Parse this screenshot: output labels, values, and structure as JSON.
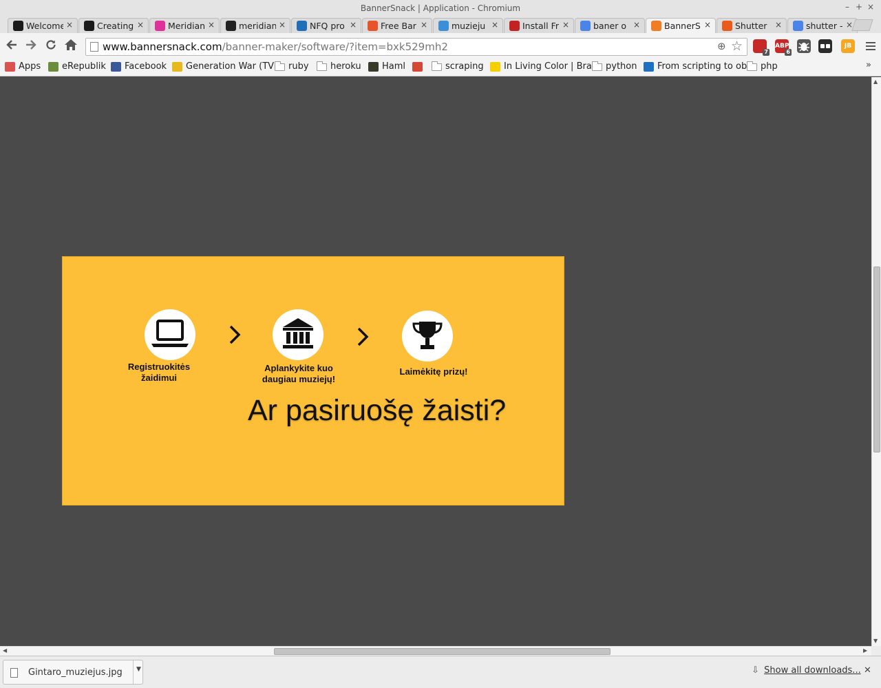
{
  "window": {
    "title": "BannerSnack | Application - Chromium",
    "controls": [
      "–",
      "+",
      "×"
    ]
  },
  "tabs": [
    {
      "label": "Welcome",
      "favicon_color": "#1a1a1a",
      "active": false
    },
    {
      "label": "Creating",
      "favicon_color": "#1a1a1a",
      "active": false
    },
    {
      "label": "Meridian",
      "favicon_color": "#e0309a",
      "active": false
    },
    {
      "label": "meridian",
      "favicon_color": "#222222",
      "active": false
    },
    {
      "label": "NFQ pro",
      "favicon_color": "#1f6fb8",
      "active": false
    },
    {
      "label": "Free Bar",
      "favicon_color": "#e7542b",
      "active": false
    },
    {
      "label": "muzieju",
      "favicon_color": "#3b8fd6",
      "active": false
    },
    {
      "label": "Install Fr",
      "favicon_color": "#c22222",
      "active": false
    },
    {
      "label": "baner o",
      "favicon_color": "#4a84e8",
      "active": false
    },
    {
      "label": "BannerS",
      "favicon_color": "#f07c23",
      "active": true
    },
    {
      "label": "Shutter",
      "favicon_color": "#e95a1d",
      "active": false
    },
    {
      "label": "shutter -",
      "favicon_color": "#4a84e8",
      "active": false
    }
  ],
  "toolbar": {
    "back_icon": "arrow-left-icon",
    "forward_icon": "arrow-right-icon",
    "reload_icon": "reload-icon",
    "home_icon": "home-icon",
    "url_host": "www.bannersnack.com",
    "url_path": "/banner-maker/software/?item=bxk529mh2",
    "extensions": [
      {
        "name": "adblock-icon",
        "color": "#c62828",
        "badge": "7"
      },
      {
        "name": "abp-icon",
        "color": "#c62828",
        "label": "ABP",
        "badge": "6"
      },
      {
        "name": "bug-icon",
        "color": "#555555"
      },
      {
        "name": "glasses-icon",
        "color": "#2c2c2c"
      },
      {
        "name": "jetbrains-icon",
        "color": "#f5a623",
        "label": "JB"
      }
    ]
  },
  "bookmarks": [
    {
      "label": "Apps",
      "icon": "apps-grid-icon",
      "color": "#d9534f"
    },
    {
      "label": "eRepublik",
      "icon": "erepublik-icon",
      "color": "#6a8c3c"
    },
    {
      "label": "Facebook",
      "icon": "facebook-icon",
      "color": "#3b5998"
    },
    {
      "label": "Generation War (TV",
      "icon": "imdb-icon",
      "color": "#e6b91e"
    },
    {
      "label": "ruby",
      "icon": "folder-icon",
      "color": "#ffffff"
    },
    {
      "label": "heroku",
      "icon": "folder-icon",
      "color": "#ffffff"
    },
    {
      "label": "Haml",
      "icon": "haml-icon",
      "color": "#3a3a2a"
    },
    {
      "label": "",
      "icon": "google-plus-icon",
      "color": "#d34836"
    },
    {
      "label": "scraping",
      "icon": "folder-icon",
      "color": "#ffffff"
    },
    {
      "label": "In Living Color | Bra",
      "icon": "natgeo-icon",
      "color": "#f5d000"
    },
    {
      "label": "python",
      "icon": "folder-icon",
      "color": "#ffffff"
    },
    {
      "label": "From scripting to ob",
      "icon": "ibm-icon",
      "color": "#1f70c1"
    },
    {
      "label": "php",
      "icon": "folder-icon",
      "color": "#ffffff"
    }
  ],
  "bookmarks_more": "»",
  "banner": {
    "background": "#fdbf38",
    "steps": [
      {
        "icon": "laptop-icon",
        "caption": "Registruokitės\nžaidimui"
      },
      {
        "icon": "museum-icon",
        "caption": "Aplankykite kuo\ndaugiau muziejų!"
      },
      {
        "icon": "trophy-icon",
        "caption": "Laimėkitę prizų!"
      }
    ],
    "headline": "Ar pasiruošę žaisti?"
  },
  "downloads": {
    "file_name": "Gintaro_muziejus.jpg",
    "show_all": "Show all downloads..."
  }
}
